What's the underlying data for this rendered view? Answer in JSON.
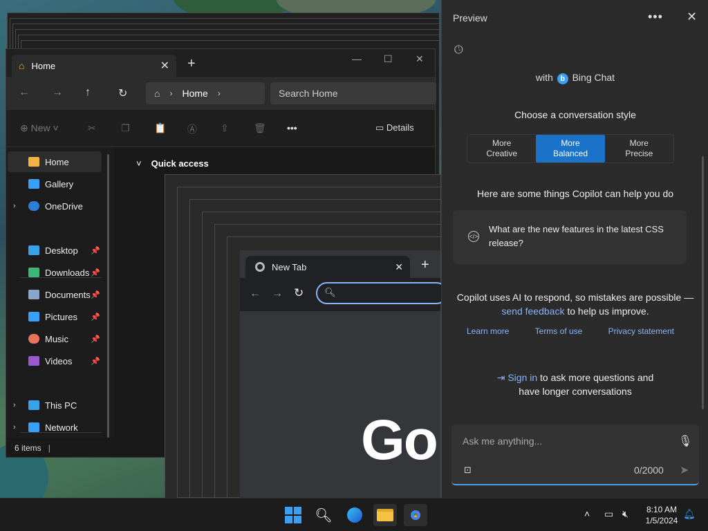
{
  "explorer": {
    "tab_title": "Home",
    "address_crumb": "Home",
    "search_placeholder": "Search Home",
    "toolbar": {
      "new_label": "New",
      "details_label": "Details"
    },
    "section_title": "Quick access",
    "sidebar": [
      {
        "label": "Home",
        "icon": "home-icon",
        "color": "#f5b342"
      },
      {
        "label": "Gallery",
        "icon": "gallery-icon",
        "color": "#3a9ff5"
      },
      {
        "label": "OneDrive",
        "icon": "cloud-icon",
        "color": "#2f7fd6"
      },
      {
        "label": "Desktop",
        "icon": "desktop-icon",
        "color": "#3aa3e8"
      },
      {
        "label": "Downloads",
        "icon": "download-icon",
        "color": "#3fb57a"
      },
      {
        "label": "Documents",
        "icon": "document-icon",
        "color": "#8aa6c8"
      },
      {
        "label": "Pictures",
        "icon": "pictures-icon",
        "color": "#3a9ff5"
      },
      {
        "label": "Music",
        "icon": "music-icon",
        "color": "#e8735a"
      },
      {
        "label": "Videos",
        "icon": "video-icon",
        "color": "#9b59d0"
      },
      {
        "label": "This PC",
        "icon": "computer-icon",
        "color": "#3aa3e8"
      },
      {
        "label": "Network",
        "icon": "network-icon",
        "color": "#3a9ff5"
      }
    ],
    "status": "6 items"
  },
  "chrome": {
    "tab_title": "New Tab",
    "logo_text": "Go"
  },
  "copilot": {
    "title": "Preview",
    "brand_prefix": "with",
    "brand_name": "Bing Chat",
    "style_heading": "Choose a conversation style",
    "styles": [
      {
        "line1": "More",
        "line2": "Creative"
      },
      {
        "line1": "More",
        "line2": "Balanced"
      },
      {
        "line1": "More",
        "line2": "Precise"
      }
    ],
    "help_heading": "Here are some things Copilot can help you do",
    "suggestion": "What are the new features in the latest CSS release?",
    "disclaimer_pre": "Copilot uses AI to respond, so mistakes are possible —",
    "disclaimer_link": "send feedback",
    "disclaimer_post": " to help us improve.",
    "links": [
      "Learn more",
      "Terms of use",
      "Privacy statement"
    ],
    "signin_link": "Sign in",
    "signin_text": " to ask more questions and",
    "signin_text2": "have longer conversations",
    "input_placeholder": "Ask me anything...",
    "char_count": "0/2000",
    "accent": "#1a73c9"
  },
  "taskbar": {
    "time": "8:10 AM",
    "date": "1/5/2024"
  }
}
